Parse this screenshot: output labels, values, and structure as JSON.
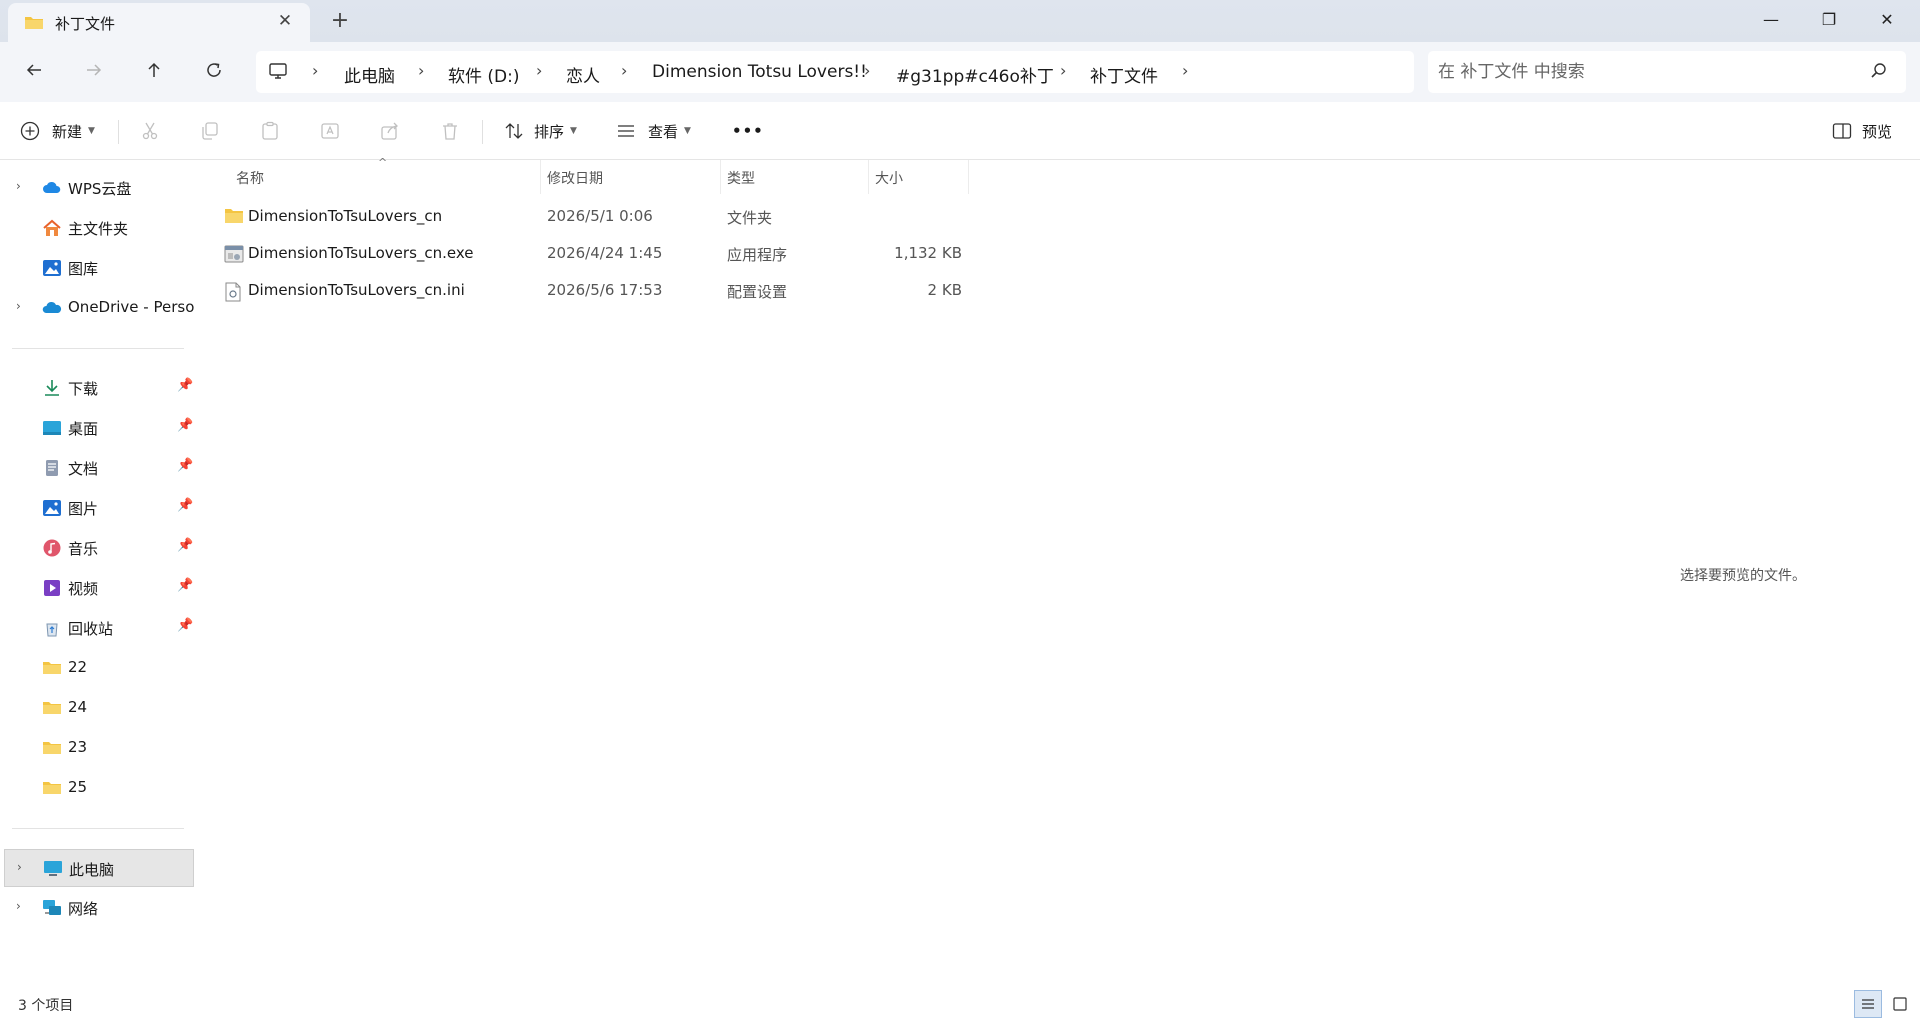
{
  "window": {
    "tab_title": "补丁文件",
    "new_tab_symbol": "+",
    "close_tab_symbol": "✕",
    "minimize_symbol": "—",
    "restore_symbol": "❐",
    "close_symbol": "✕"
  },
  "address": {
    "crumbs": [
      "此电脑",
      "软件 (D:)",
      "恋人",
      "Dimension Totsu Lovers!!",
      "#g31pp#c46o补丁",
      "补丁文件"
    ],
    "search_placeholder": "在 补丁文件 中搜索"
  },
  "toolbar": {
    "new_label": "新建",
    "sort_label": "排序",
    "view_label": "查看",
    "more_label": "•••",
    "preview_label": "预览"
  },
  "sidebar": {
    "cloud_items": [
      {
        "label": "WPS云盘",
        "icon": "wps-cloud-icon",
        "expandable": true
      },
      {
        "label": "主文件夹",
        "icon": "home-icon",
        "expandable": false
      },
      {
        "label": "图库",
        "icon": "gallery-icon",
        "expandable": false
      },
      {
        "label": "OneDrive - Personal",
        "icon": "onedrive-icon",
        "expandable": true
      }
    ],
    "quick_items": [
      {
        "label": "下载",
        "icon": "download-icon"
      },
      {
        "label": "桌面",
        "icon": "desktop-icon"
      },
      {
        "label": "文档",
        "icon": "documents-icon"
      },
      {
        "label": "图片",
        "icon": "pictures-icon"
      },
      {
        "label": "音乐",
        "icon": "music-icon"
      },
      {
        "label": "视频",
        "icon": "videos-icon"
      },
      {
        "label": "回收站",
        "icon": "recycle-bin-icon"
      }
    ],
    "folder_items": [
      "22",
      "24",
      "23",
      "25"
    ],
    "bottom_items": [
      {
        "label": "此电脑",
        "icon": "this-pc-icon",
        "selected": true
      },
      {
        "label": "网络",
        "icon": "network-icon",
        "selected": false
      }
    ]
  },
  "columns": {
    "name": "名称",
    "date": "修改日期",
    "type": "类型",
    "size": "大小"
  },
  "files": [
    {
      "name": "DimensionToTsuLovers_cn",
      "date": "2026/5/1 0:06",
      "type": "文件夹",
      "size": "",
      "icon": "folder-icon"
    },
    {
      "name": "DimensionToTsuLovers_cn.exe",
      "date": "2026/4/24 1:45",
      "type": "应用程序",
      "size": "1,132 KB",
      "icon": "exe-icon"
    },
    {
      "name": "DimensionToTsuLovers_cn.ini",
      "date": "2026/5/6 17:53",
      "type": "配置设置",
      "size": "2 KB",
      "icon": "ini-file-icon"
    }
  ],
  "preview": {
    "empty_text": "选择要预览的文件。"
  },
  "status": {
    "item_count": "3 个项目"
  },
  "colors": {
    "folder_yellow": "#f4c542",
    "accent_blue": "#1f6fd1",
    "titlebar_bg": "#dfe5ee",
    "selected_bg": "#e6e6e6"
  }
}
